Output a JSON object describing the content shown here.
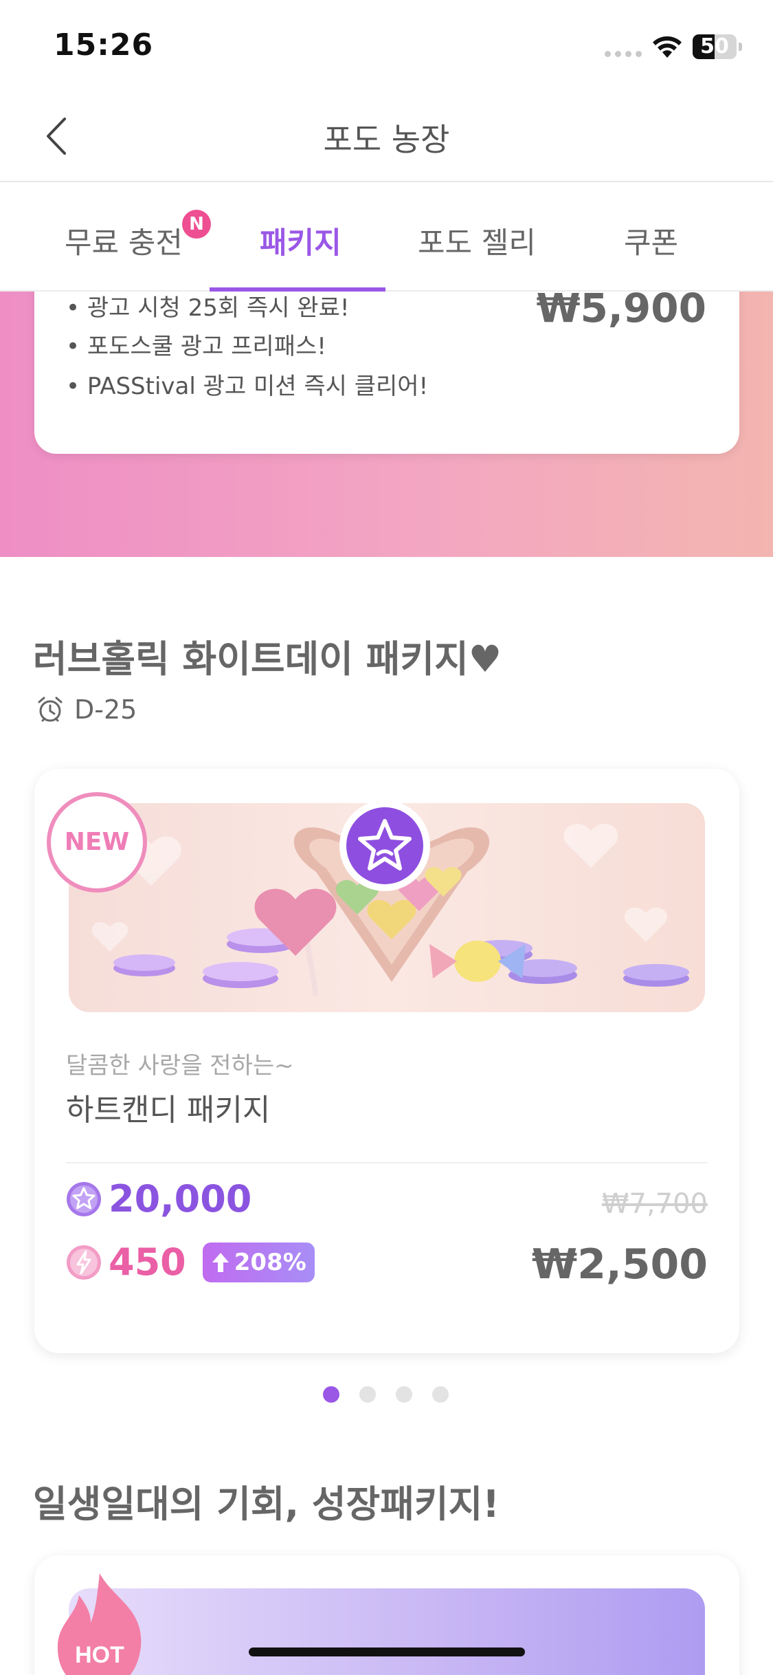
{
  "status_bar": {
    "time": "15:26",
    "battery": "50",
    "battery_level": 0.5
  },
  "nav": {
    "title": "포도 농장"
  },
  "tabs": [
    {
      "label": "무료 충전",
      "badge": "N"
    },
    {
      "label": "패키지",
      "active": true
    },
    {
      "label": "포도 젤리"
    },
    {
      "label": "쿠폰"
    }
  ],
  "top_card": {
    "lines": [
      "• 광고 시청 25회 즉시 완료!",
      "• 포도스쿨 광고 프리패스!",
      "• PASStival 광고 미션 즉시 클리어!"
    ],
    "price": "₩5,900"
  },
  "section1": {
    "title": "러브홀릭 화이트데이 패키지♥",
    "dday": "D-25",
    "card": {
      "badge": "NEW",
      "subtitle": "달콤한 사랑을 전하는~",
      "name": "하트캔디 패키지",
      "star_amount": "20,000",
      "bolt_amount": "450",
      "bonus": "208%",
      "original_price": "₩7,700",
      "price": "₩2,500"
    },
    "pager": {
      "count": 4,
      "active": 0
    }
  },
  "section2": {
    "title": "일생일대의 기회, 성장패키지!",
    "badge": "HOT"
  },
  "colors": {
    "accent": "#9a57e6",
    "pink": "#ea5fa6",
    "banner_start": "#ee8ec5",
    "banner_end": "#f3b5b0"
  }
}
